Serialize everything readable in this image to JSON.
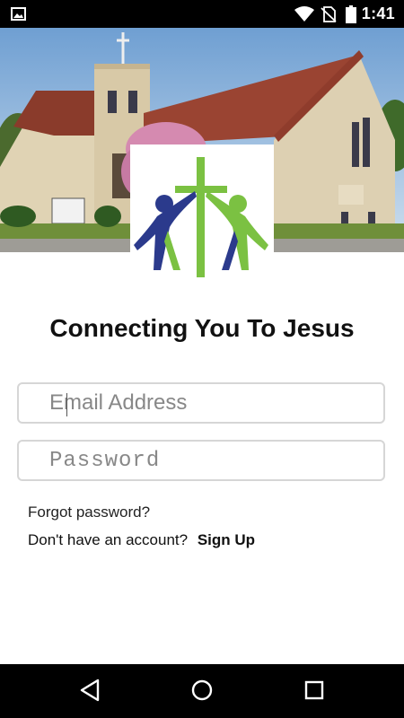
{
  "status_bar": {
    "time": "1:41",
    "icons": [
      "image-icon",
      "wifi-icon",
      "no-sim-icon",
      "battery-icon"
    ]
  },
  "header": {
    "image": "church-photo",
    "logo": "cross-with-two-figures-logo",
    "colors": {
      "green": "#7bc142",
      "blue": "#2b3a8c"
    }
  },
  "tagline": "Connecting You To Jesus",
  "login": {
    "email_placeholder": "Email Address",
    "email_value": "",
    "password_placeholder": "Password",
    "password_value": "",
    "forgot_password": "Forgot password?",
    "no_account": "Don't have an account?",
    "sign_up": "Sign Up"
  },
  "nav_bar": {
    "icons": [
      "back-icon",
      "home-icon",
      "recent-apps-icon"
    ]
  }
}
